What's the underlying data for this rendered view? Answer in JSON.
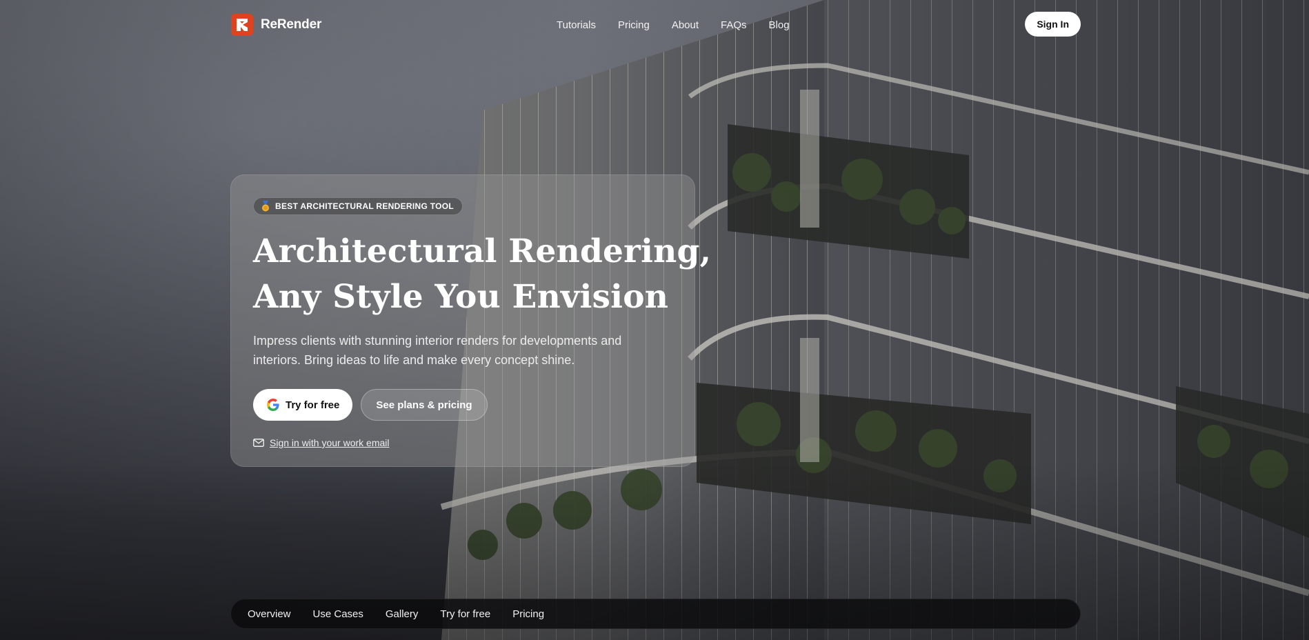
{
  "brand": {
    "name": "ReRender",
    "logo_color": "#e0421f",
    "logo_icon": "rerender-logo-icon"
  },
  "nav": {
    "links": [
      "Tutorials",
      "Pricing",
      "About",
      "FAQs",
      "Blog"
    ],
    "signin_label": "Sign In"
  },
  "hero": {
    "badge_icon": "medal-icon",
    "badge_text": "BEST ARCHITECTURAL RENDERING TOOL",
    "headline_line1": "Architectural Rendering,",
    "headline_line2": "Any Style You Envision",
    "subtitle": "Impress clients with stunning interior renders for developments and interiors. Bring ideas to life and make every concept shine.",
    "primary_cta": "Try for free",
    "primary_cta_icon": "google-icon",
    "secondary_cta": "See plans & pricing",
    "email_icon": "mail-icon",
    "email_link": "Sign in with your work email"
  },
  "subnav": {
    "items": [
      "Overview",
      "Use Cases",
      "Gallery",
      "Try for free",
      "Pricing"
    ]
  }
}
